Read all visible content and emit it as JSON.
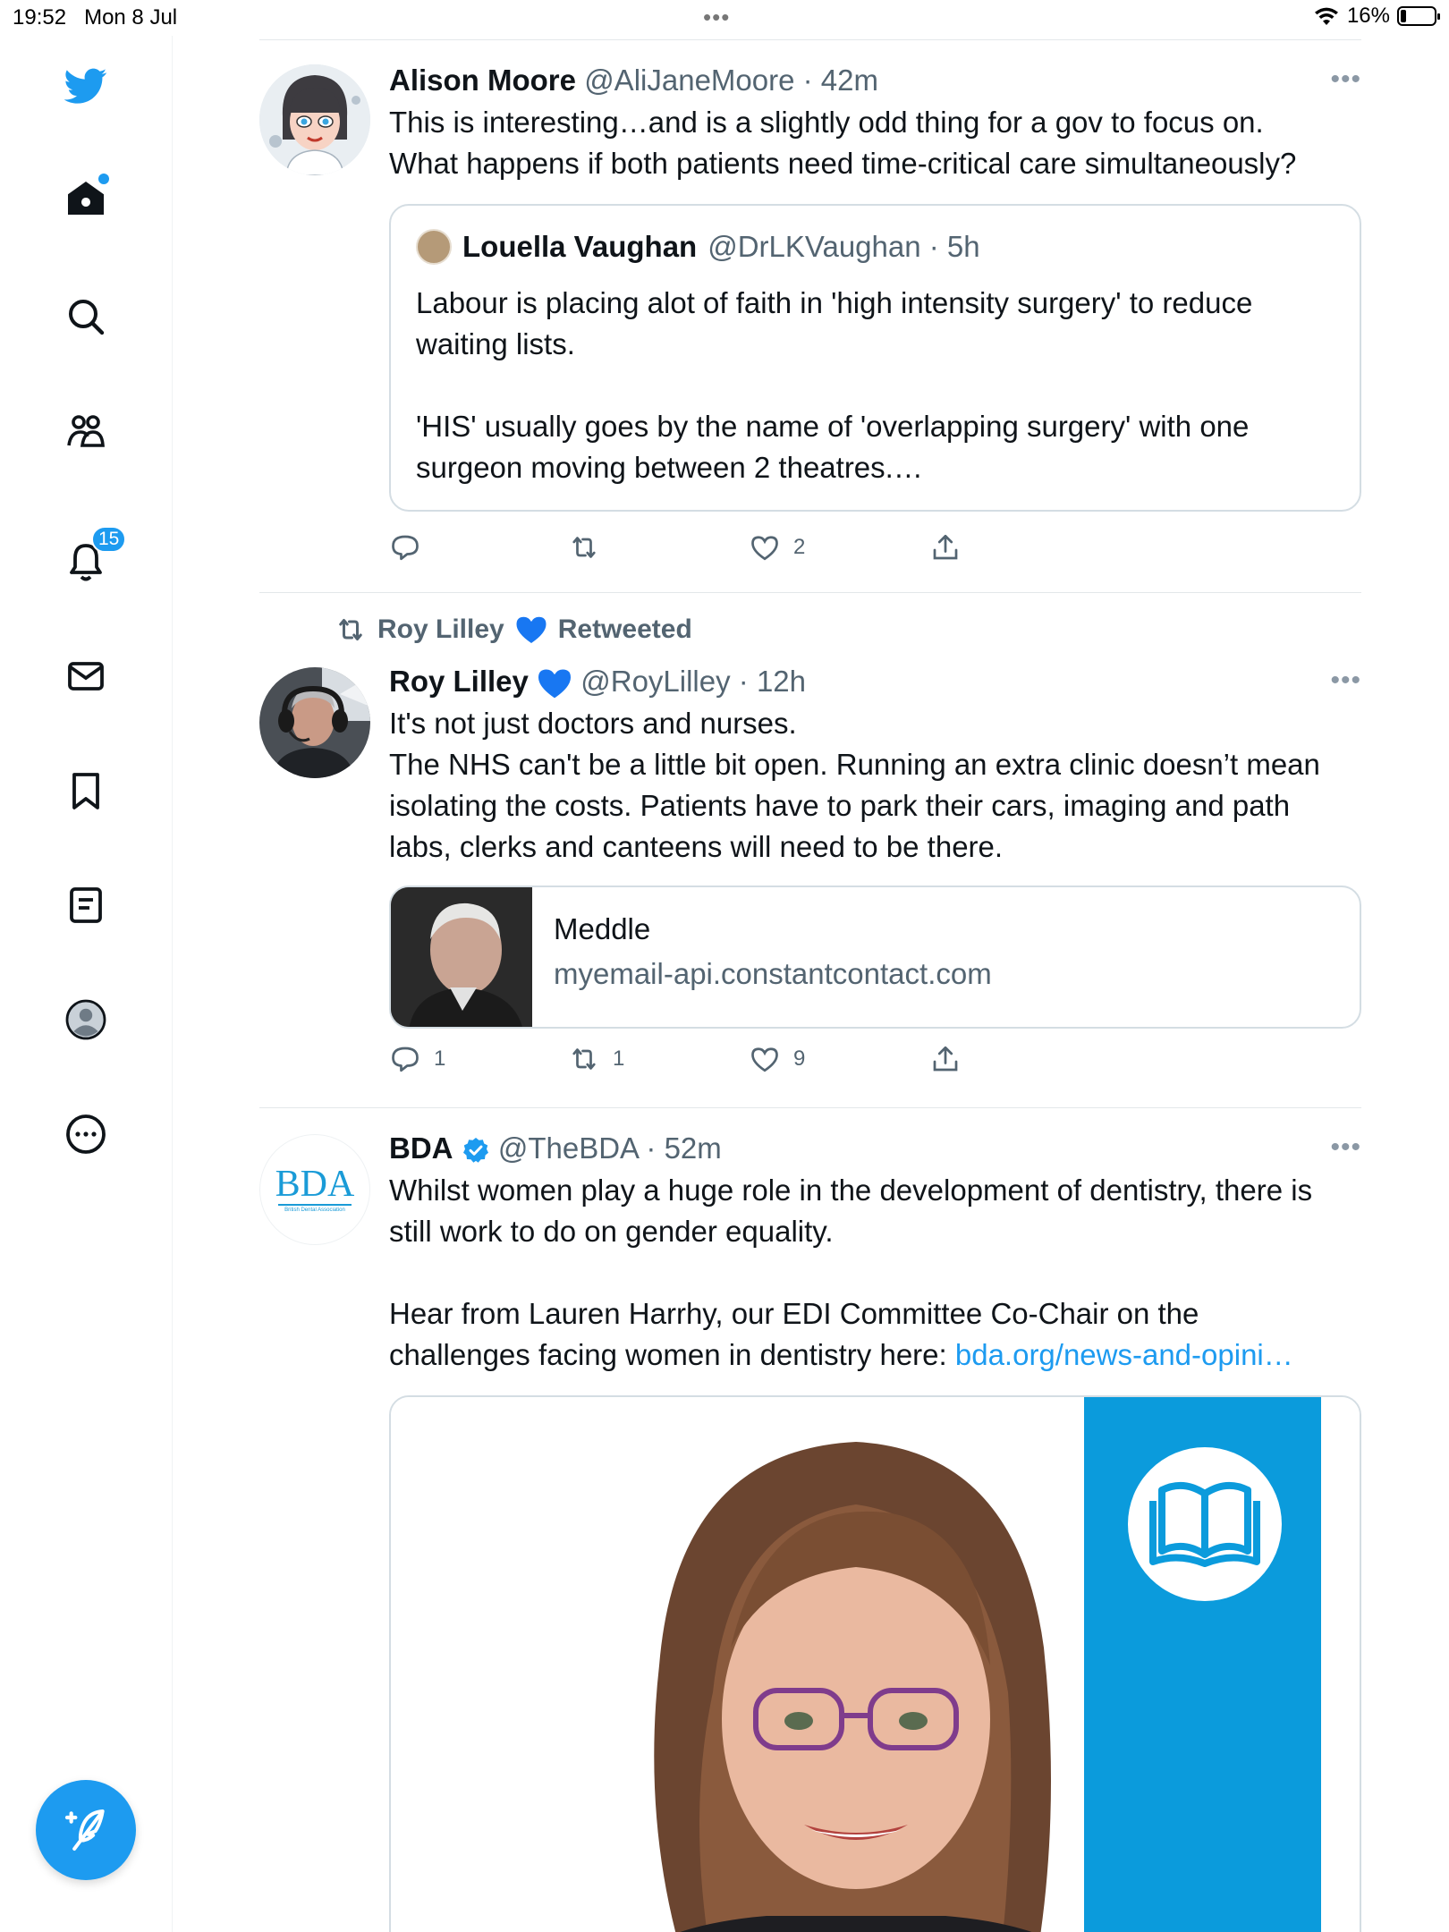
{
  "status_bar": {
    "time": "19:52",
    "date": "Mon 8 Jul",
    "dots": "•••",
    "battery_percent": "16%",
    "battery_level": 0.16
  },
  "sidebar": {
    "items": [
      {
        "name": "twitter-logo",
        "icon": "bird-icon"
      },
      {
        "name": "home",
        "icon": "home-icon"
      },
      {
        "name": "explore",
        "icon": "search-icon"
      },
      {
        "name": "communities",
        "icon": "people-icon"
      },
      {
        "name": "notifications",
        "icon": "bell-icon",
        "badge": "15"
      },
      {
        "name": "messages",
        "icon": "envelope-icon"
      },
      {
        "name": "bookmarks",
        "icon": "bookmark-icon"
      },
      {
        "name": "lists",
        "icon": "list-icon"
      },
      {
        "name": "profile",
        "icon": "profile-icon"
      },
      {
        "name": "more",
        "icon": "more-circle-icon"
      }
    ],
    "compose_icon": "compose-icon"
  },
  "colors": {
    "accent": "#1d9bf0",
    "text": "#0f1419",
    "muted": "#536471",
    "border": "#d4dde3",
    "bda_blue": "#0b9bdc"
  },
  "tweets": [
    {
      "name": "Alison Moore",
      "handle": "@AliJaneMoore",
      "time": "42m",
      "text": "This is interesting…and is a slightly odd thing for a gov to focus on.\nWhat happens if both patients need time-critical care simultaneously?",
      "quote": {
        "name": "Louella Vaughan",
        "handle": "@DrLKVaughan",
        "time": "5h",
        "text": "Labour is placing alot of faith in 'high intensity surgery' to reduce\nwaiting lists.\n\n'HIS' usually goes by the name of 'overlapping surgery' with one\nsurgeon moving between 2 theatres.…"
      },
      "replies": "",
      "retweets": "",
      "likes": "2"
    },
    {
      "retweeted_by": "Roy Lilley",
      "retweeted_label": "Retweeted",
      "name": "Roy Lilley",
      "handle": "@RoyLilley",
      "time": "12h",
      "text": "It's not just doctors and nurses.\nThe NHS can't be a little bit open. Running an extra clinic doesn’t mean\nisolating the costs. Patients have to park their cars, imaging and path\nlabs, clerks and canteens will need to be there.",
      "card": {
        "title": "Meddle",
        "domain": "myemail-api.constantcontact.com"
      },
      "replies": "1",
      "retweets": "1",
      "likes": "9"
    },
    {
      "name": "BDA",
      "handle": "@TheBDA",
      "time": "52m",
      "text_a": "Whilst women play a huge role in the development of dentistry, there is\nstill work to do on gender equality.\n\nHear from Lauren Harrhy, our EDI Committee Co-Chair on the\nchallenges facing women in dentistry here: ",
      "link": "bda.org/news-and-opini…",
      "avatar_logo": "BDA",
      "avatar_sub": "British Dental Association"
    }
  ]
}
